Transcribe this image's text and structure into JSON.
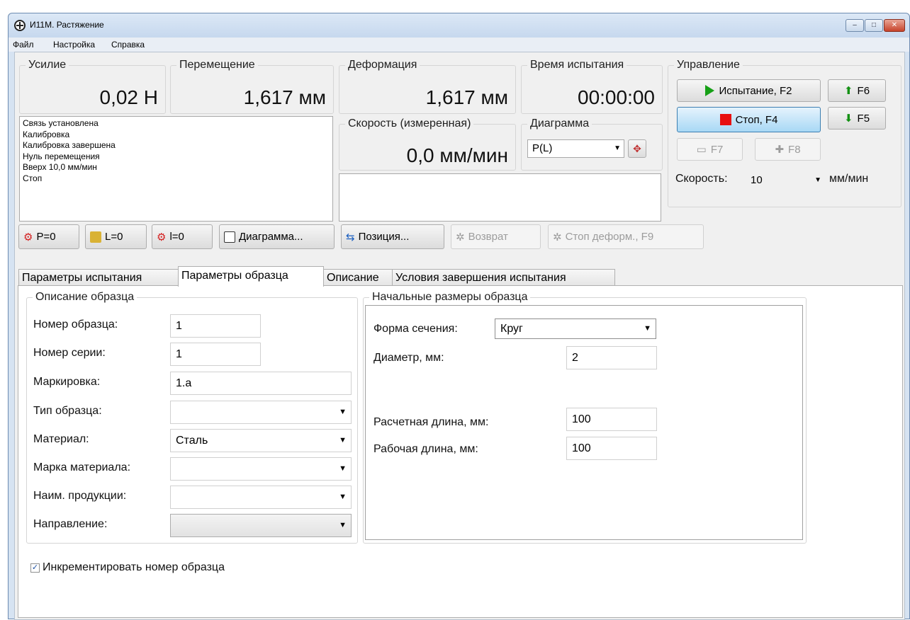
{
  "window": {
    "title": "И11М. Растяжение",
    "controls": {
      "minimize": "‒",
      "maximize": "□",
      "close": "✕"
    }
  },
  "menu": [
    "Файл",
    "Настройка",
    "Справка"
  ],
  "readouts": {
    "force": {
      "title": "Усилие",
      "value": "0,02 Н"
    },
    "displacement": {
      "title": "Перемещение",
      "value": "1,617 мм"
    },
    "deformation": {
      "title": "Деформация",
      "value": "1,617 мм"
    },
    "test_time": {
      "title": "Время испытания",
      "value": "00:00:00"
    },
    "speed_measured": {
      "title": "Скорость (измеренная)",
      "value": "0,0 мм/мин"
    }
  },
  "diagram": {
    "title": "Диаграмма",
    "selected": "P(L)"
  },
  "control": {
    "title": "Управление",
    "test_button": "Испытание, F2",
    "stop_button": "Стоп, F4",
    "f6_button": "F6",
    "f5_button": "F5",
    "f7_button": "F7",
    "f8_button": "F8",
    "speed_label": "Скорость:",
    "speed_value": "10",
    "speed_unit": "мм/мин"
  },
  "log": [
    "Связь установлена",
    "Калибровка",
    "Калибровка завершена",
    "Нуль перемещения",
    "Вверх 10,0 мм/мин",
    "Стоп"
  ],
  "toolbar": {
    "p_zero": "P=0",
    "l_zero": "L=0",
    "i_zero": "l=0",
    "diagram": "Диаграмма...",
    "position": "Позиция...",
    "return": "Возврат",
    "stop_deform": "Стоп деформ., F9"
  },
  "tabs": [
    "Параметры испытания",
    "Параметры образца",
    "Описание",
    "Условия завершения испытания"
  ],
  "sample_desc": {
    "title": "Описание образца",
    "fields": [
      {
        "label": "Номер образца:",
        "value": "1"
      },
      {
        "label": "Номер серии:",
        "value": "1"
      },
      {
        "label": "Маркировка:",
        "value": "1.а"
      },
      {
        "label": "Тип образца:",
        "value": ""
      },
      {
        "label": "Материал:",
        "value": "Сталь"
      },
      {
        "label": "Марка материала:",
        "value": ""
      },
      {
        "label": "Наим. продукции:",
        "value": ""
      },
      {
        "label": "Направление:",
        "value": ""
      }
    ]
  },
  "dimensions": {
    "title": "Начальные размеры образца",
    "section_label": "Форма сечения:",
    "section_value": "Круг",
    "diameter_label": "Диаметр, мм:",
    "diameter_value": "2",
    "calc_length_label": "Расчетная длина, мм:",
    "calc_length_value": "100",
    "work_length_label": "Рабочая длина, мм:",
    "work_length_value": "100"
  },
  "increment": {
    "label": "Инкрементировать номер образца",
    "checked": true
  }
}
